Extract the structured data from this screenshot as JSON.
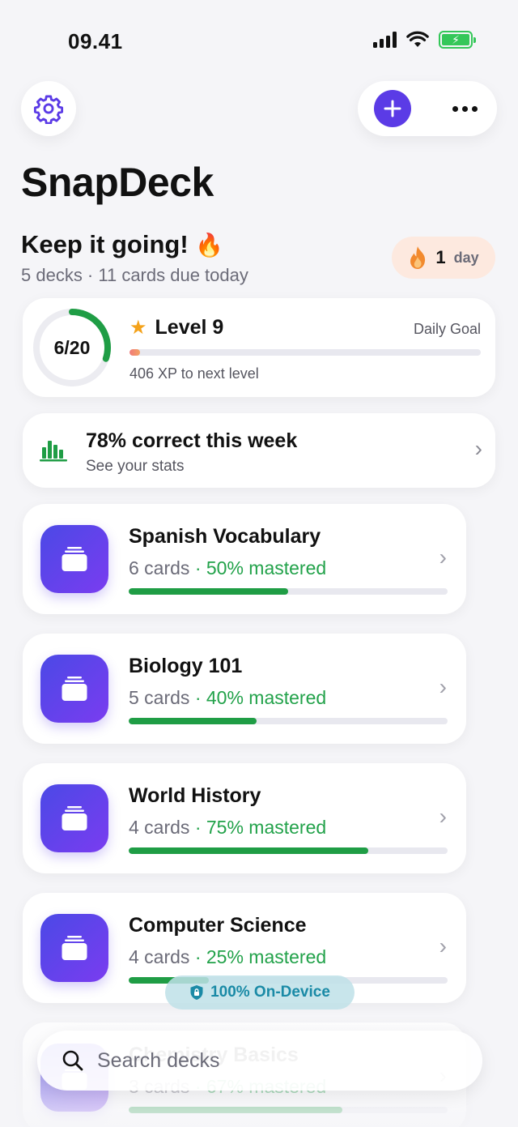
{
  "status": {
    "time": "09.41"
  },
  "header": {
    "app_title": "SnapDeck"
  },
  "summary": {
    "greeting": "Keep it going!",
    "greeting_emoji": "🔥",
    "subtitle": "5 decks · 11 cards due today",
    "streak_count": "1",
    "streak_label": "day"
  },
  "level_card": {
    "goal_progress": "6/20",
    "goal_done": 6,
    "goal_total": 20,
    "level": "Level 9",
    "daily_goal_label": "Daily Goal",
    "xp_text": "406 XP to next level",
    "xp_progress": 0.03
  },
  "stats_card": {
    "title": "78% correct this week",
    "subtitle": "See your stats"
  },
  "decks": [
    {
      "name": "Spanish Vocabulary",
      "cards": "6 cards",
      "mastered": "· 50% mastered",
      "progress": 0.5
    },
    {
      "name": "Biology 101",
      "cards": "5 cards",
      "mastered": "· 40% mastered",
      "progress": 0.4
    },
    {
      "name": "World History",
      "cards": "4 cards",
      "mastered": "· 75% mastered",
      "progress": 0.75
    },
    {
      "name": "Computer Science",
      "cards": "4 cards",
      "mastered": "· 25% mastered",
      "progress": 0.25
    },
    {
      "name": "Chemistry Basics",
      "cards": "3 cards",
      "mastered": "· 67% mastered",
      "progress": 0.67
    }
  ],
  "badge": {
    "on_device": "100% On-Device"
  },
  "search": {
    "placeholder": "Search decks"
  },
  "colors": {
    "accent": "#5b3be6",
    "success": "#22a24a",
    "streak_bg": "#fde9df"
  }
}
